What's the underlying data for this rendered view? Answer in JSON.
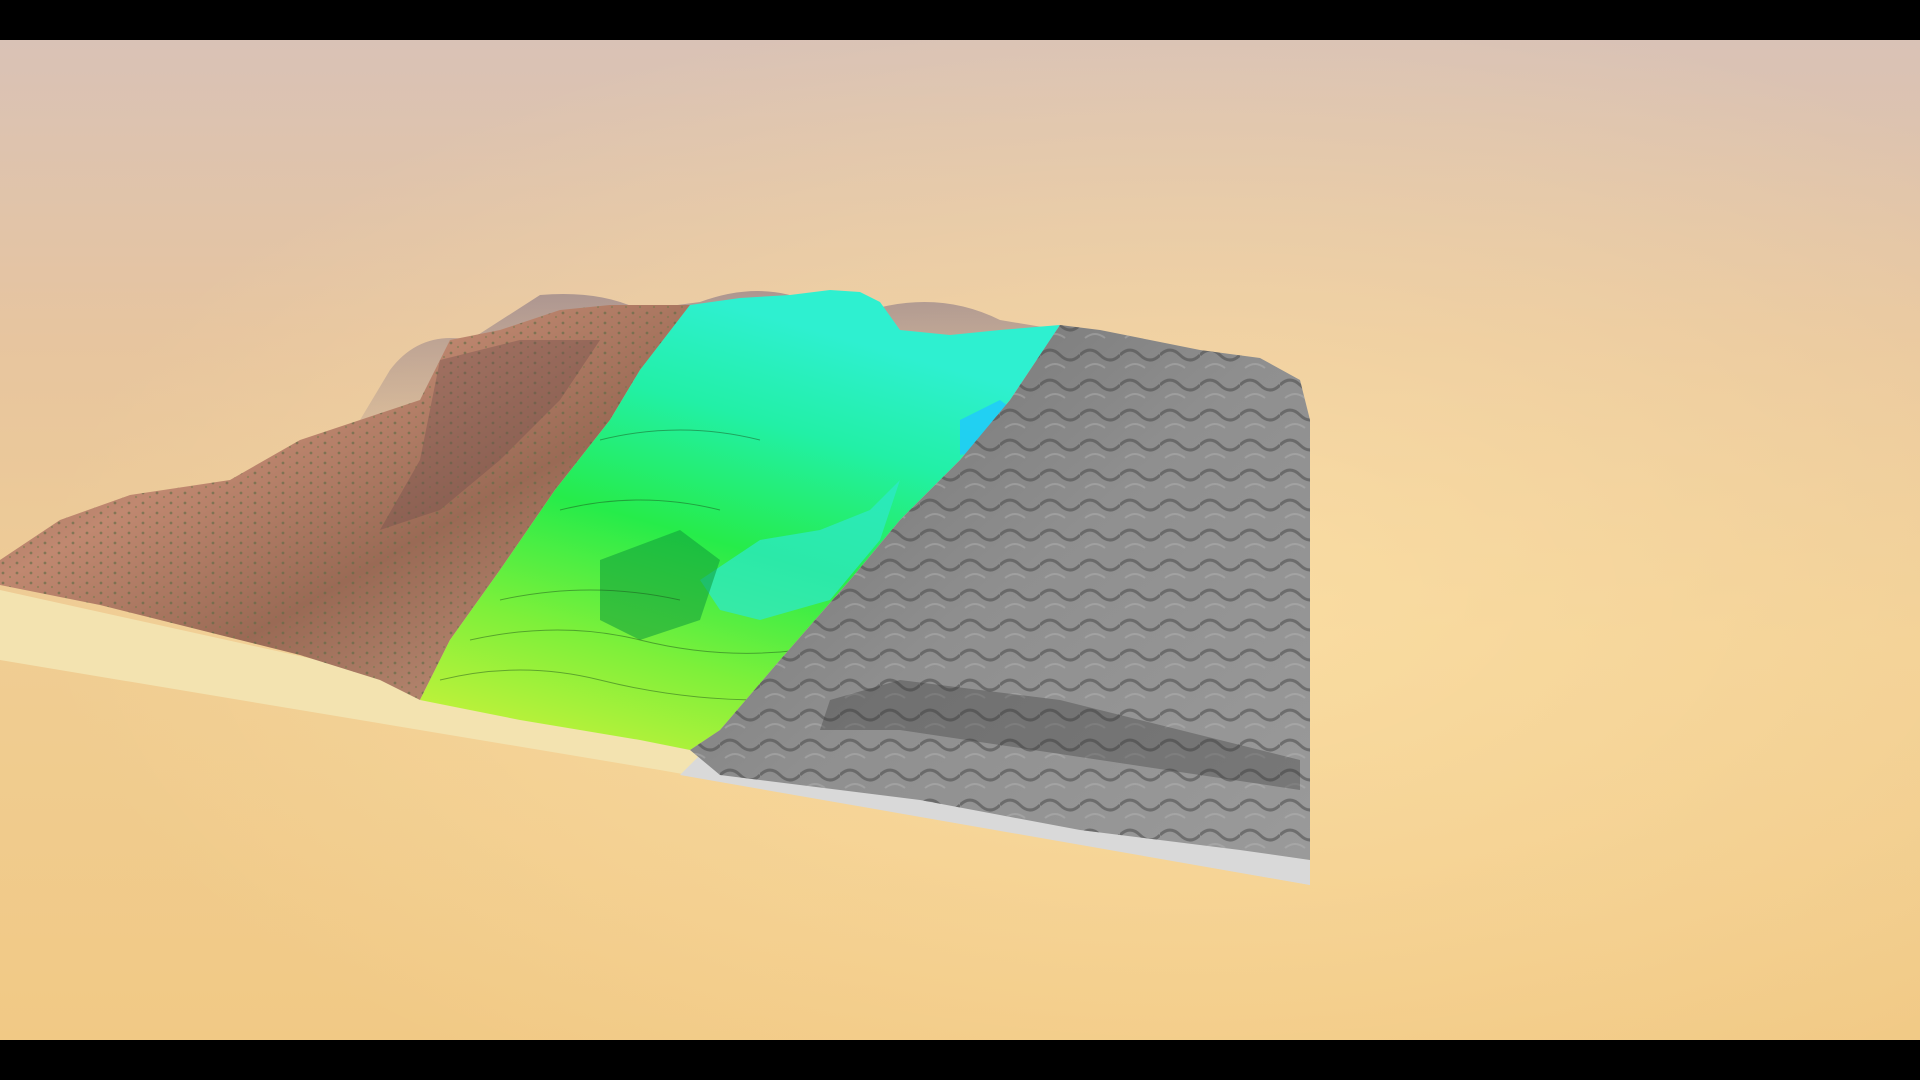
{
  "scene": {
    "subject": "terrain-model",
    "panels": [
      {
        "id": "satellite-texture",
        "style": "photographic",
        "dominant_color": "#b98a72"
      },
      {
        "id": "elevation-colormap",
        "style": "color-ramp",
        "colors": [
          "#c8f23a",
          "#2cf04a",
          "#2af0b4",
          "#1fd8ff"
        ]
      },
      {
        "id": "hillshade-grayscale",
        "style": "shaded-relief",
        "dominant_color": "#8a8a8a"
      }
    ],
    "background_colors": [
      "#d9c2b6",
      "#f0cd93",
      "#f1c985"
    ],
    "letterbox_color": "#000000"
  }
}
